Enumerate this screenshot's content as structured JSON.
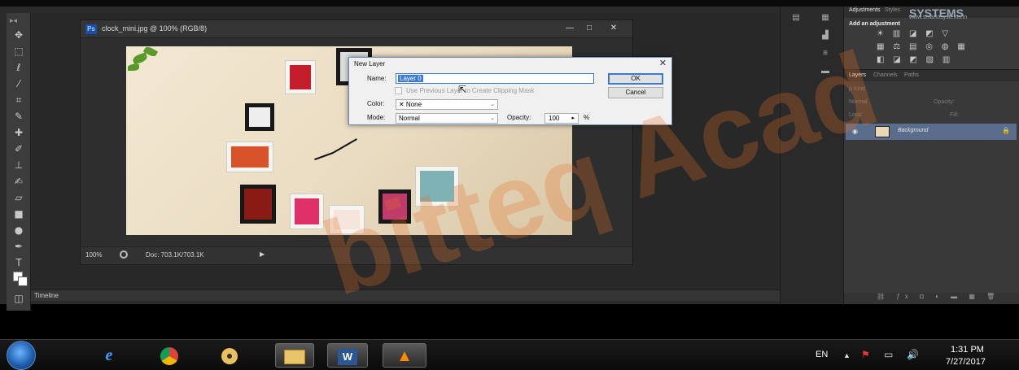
{
  "document": {
    "title": "clock_mini.jpg @ 100% (RGB/8)",
    "badge": "Ps",
    "zoom": "100%",
    "doc_size": "Doc: 703.1K/703.1K",
    "minimize": "—",
    "maximize": "□",
    "close": "✕"
  },
  "timeline": {
    "label": "Timeline"
  },
  "adjustments": {
    "tab_adjustments": "Adjustments",
    "tab_styles": "Styles",
    "title": "Add an adjustment",
    "row1": "☀ ▥ ◪ ◩ ▽",
    "row2": "▦ ⚖ ▤ ◎ ◍ ▦",
    "row3": "◧ ◪ ◩ ▨ ▥",
    "brand": "SYSTEMS",
    "brand_url": "www.smartosystems.in"
  },
  "layers": {
    "tabs": [
      "Layers",
      "Channels",
      "Paths"
    ],
    "kind": "ρ Kind",
    "blend": "Normal",
    "opacity": "Opacity:",
    "lock": "Lock:",
    "fill": "Fill:",
    "layer_name": "Background"
  },
  "dialog": {
    "title": "New Layer",
    "name_label": "Name:",
    "name_value": "Layer 0",
    "clip_label": "Use Previous Layer to Create Clipping Mask",
    "color_label": "Color:",
    "color_value": "✕ None",
    "mode_label": "Mode:",
    "mode_value": "Normal",
    "opacity_label": "Opacity:",
    "opacity_value": "100",
    "opacity_unit": "%",
    "ok": "OK",
    "cancel": "Cancel",
    "close": "✕"
  },
  "taskbar": {
    "lang": "EN",
    "time": "1:31 PM",
    "date": "7/27/2017",
    "tray_up": "▲",
    "tray_flag": "⚑",
    "tray_network": "▭",
    "tray_volume": "🔊",
    "apps": [
      "internet-explorer",
      "chrome",
      "media-player",
      "file-explorer",
      "word",
      "vlc"
    ]
  },
  "watermark": "bitteq Acad",
  "colors": {
    "accent": "#3b7ad0",
    "layer_selected": "#5b6d8c",
    "ps_bg": "#2b2b2b"
  }
}
